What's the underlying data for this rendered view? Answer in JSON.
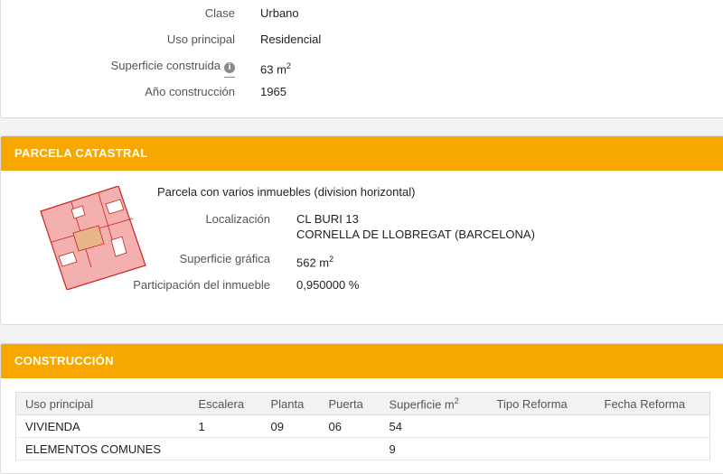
{
  "inmueble": {
    "rows": [
      {
        "label": "Clase",
        "value": "Urbano"
      },
      {
        "label": "Uso principal",
        "value": "Residencial"
      },
      {
        "label": "Superficie construida",
        "value": "63 m",
        "sup": "2",
        "info_icon": "info-icon"
      },
      {
        "label": "Año construcción",
        "value": "1965"
      }
    ]
  },
  "parcela": {
    "header": "PARCELA CATASTRAL",
    "description": "Parcela con varios inmuebles (division horizontal)",
    "localizacion_label": "Localización",
    "localizacion_line1": "CL BURI 13",
    "localizacion_line2": "CORNELLA DE LLOBREGAT (BARCELONA)",
    "superficie_label": "Superficie gráfica",
    "superficie_value": "562 m",
    "superficie_sup": "2",
    "participacion_label": "Participación del inmueble",
    "participacion_value": "0,950000 %",
    "map_colors": {
      "fill": "#f4b0ae",
      "outline": "#cc2222",
      "highlight": "#e8b48a"
    }
  },
  "construccion": {
    "header": "CONSTRUCCIÓN",
    "columns": [
      "Uso principal",
      "Escalera",
      "Planta",
      "Puerta",
      "Superficie m",
      "Tipo Reforma",
      "Fecha Reforma"
    ],
    "superficie_sup": "2",
    "rows": [
      {
        "uso": "VIVIENDA",
        "escalera": "1",
        "planta": "09",
        "puerta": "06",
        "superficie": "54",
        "tipo": "",
        "fecha": ""
      },
      {
        "uso": "ELEMENTOS COMUNES",
        "escalera": "",
        "planta": "",
        "puerta": "",
        "superficie": "9",
        "tipo": "",
        "fecha": ""
      }
    ]
  }
}
